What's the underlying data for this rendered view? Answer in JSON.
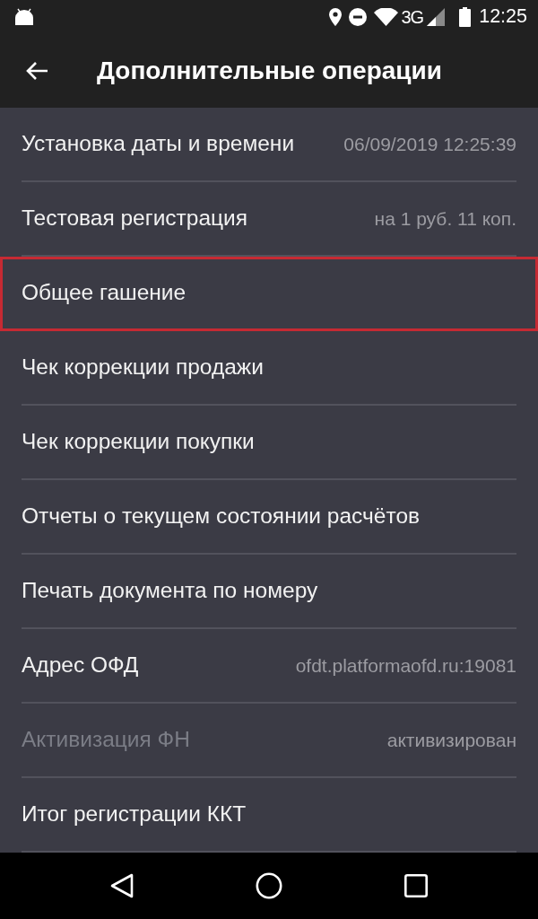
{
  "status_bar": {
    "network": "3G",
    "time": "12:25"
  },
  "toolbar": {
    "title": "Дополнительные операции"
  },
  "items": [
    {
      "label": "Установка даты и времени",
      "value": "06/09/2019 12:25:39",
      "disabled": false,
      "highlighted": false
    },
    {
      "label": "Тестовая регистрация",
      "value": "на 1 руб. 11 коп.",
      "disabled": false,
      "highlighted": false
    },
    {
      "label": "Общее гашение",
      "disabled": false,
      "highlighted": true
    },
    {
      "label": "Чек коррекции продажи",
      "disabled": false,
      "highlighted": false
    },
    {
      "label": "Чек коррекции покупки",
      "disabled": false,
      "highlighted": false
    },
    {
      "label": "Отчеты о текущем состоянии расчётов",
      "disabled": false,
      "highlighted": false
    },
    {
      "label": "Печать документа по номеру",
      "disabled": false,
      "highlighted": false
    },
    {
      "label": "Адрес ОФД",
      "value": "ofdt.platformaofd.ru:19081",
      "disabled": false,
      "highlighted": false
    },
    {
      "label": "Активизация ФН",
      "value": "активизирован",
      "disabled": true,
      "highlighted": false
    },
    {
      "label": "Итог регистрации ККТ",
      "disabled": false,
      "highlighted": false
    }
  ]
}
